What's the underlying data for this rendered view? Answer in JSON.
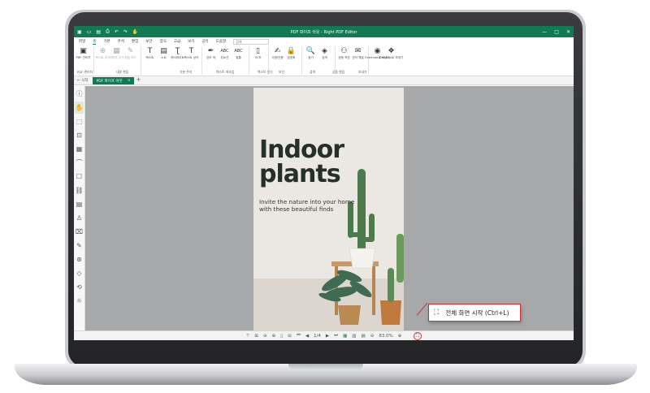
{
  "window": {
    "title": "PDF 파이프 아웃 - Right PDF Editor",
    "controls": [
      "—",
      "□",
      "✕"
    ]
  },
  "menu": {
    "items": [
      "파일",
      "홈",
      "기본",
      "주석",
      "편집",
      "보안",
      "양식",
      "고급",
      "보기",
      "공유",
      "도움말"
    ],
    "active_index": 1,
    "search_placeholder": "검색"
  },
  "ribbon": {
    "items": [
      {
        "icon": "pdf-manage-icon",
        "glyph": "▣",
        "label": "PDF 관리자"
      },
      {
        "icon": "add-text-icon",
        "glyph": "⊕",
        "label": "텍스트 추가",
        "dim": true
      },
      {
        "icon": "add-image-icon",
        "glyph": "▦",
        "label": "이미지 추가",
        "dim": true
      },
      {
        "icon": "edit-icon",
        "glyph": "✎",
        "label": "편집 모드",
        "dim": true
      },
      {
        "icon": "text-icon",
        "glyph": "T",
        "label": "텍스트"
      },
      {
        "icon": "note-icon",
        "glyph": "▤",
        "label": "노트"
      },
      {
        "icon": "highlight-icon",
        "glyph": "Ʈ",
        "label": "하이라이트"
      },
      {
        "icon": "textbox-icon",
        "glyph": "T",
        "label": "텍스트 상자"
      },
      {
        "icon": "sign-icon",
        "glyph": "✒",
        "label": "강조 색"
      },
      {
        "icon": "abc-icon",
        "glyph": "ABC",
        "label": "취소선"
      },
      {
        "icon": "abc2-icon",
        "glyph": "ABC",
        "label": "밑줄"
      },
      {
        "icon": "ocr-icon",
        "glyph": "▯",
        "label": "OCR"
      },
      {
        "icon": "stamp-icon",
        "glyph": "✍",
        "label": "서명/인증"
      },
      {
        "icon": "lock-icon",
        "glyph": "🔒",
        "label": "암호화"
      },
      {
        "icon": "search-icon",
        "glyph": "🔍",
        "label": "찾기"
      },
      {
        "icon": "car-icon",
        "glyph": "◈",
        "label": "검색"
      },
      {
        "icon": "share-icon",
        "glyph": "⚇",
        "label": "공동 작업"
      },
      {
        "icon": "email-icon",
        "glyph": "✉",
        "label": "전자 메일"
      },
      {
        "icon": "evernote-icon",
        "glyph": "◉",
        "label": "Evernote로 보내기"
      },
      {
        "icon": "dropbox-icon",
        "glyph": "❖",
        "label": "Dropbox로 보내기"
      }
    ],
    "groups": [
      "PDF 관리자",
      "내용 편집",
      "기본 주석",
      "텍스트 마크업",
      "텍스트 인식",
      "보안",
      "검색",
      "공동 편집",
      "보내기"
    ]
  },
  "tabs": {
    "home": "← 시작",
    "doc": "PDF 파이프 아웃",
    "close": "×",
    "add": "+"
  },
  "sidebar": {
    "icons": [
      "info-icon",
      "hand-icon",
      "select-icon",
      "bookmark-icon",
      "thumbnails-icon",
      "attachment-icon",
      "comment-icon",
      "link-icon",
      "layers-icon",
      "stamp-icon",
      "signature-icon",
      "pen-icon",
      "globe-icon",
      "tag-icon",
      "history-icon",
      "accessibility-icon"
    ],
    "glyphs": [
      "ⓘ",
      "✋",
      "⬚",
      "⊡",
      "▦",
      "⌒",
      "☐",
      "⛓",
      "▤",
      "♙",
      "⌧",
      "✎",
      "⊛",
      "◇",
      "⟲",
      "☼"
    ]
  },
  "page": {
    "heading_line1": "Indoor",
    "heading_line2": "plants",
    "tagline_line1": "Invite the nature into your home",
    "tagline_line2": "with these beautiful finds"
  },
  "statusbar": {
    "controls": [
      "⊤",
      "⊞",
      "⊖",
      "⊕",
      "▯",
      "⊟",
      "⏮",
      "◀",
      "1/4",
      "▶",
      "⏭",
      "▦",
      "▥",
      "▤",
      "⊖",
      "83.0%",
      "⊕"
    ],
    "zoom": "83.0%",
    "page_indicator": "1/4"
  },
  "tooltip": {
    "text": "전체 화면 시작 (Ctrl+L)",
    "icon": "fullscreen-icon"
  },
  "colors": {
    "brand": "#0f7a54",
    "canvas": "#a6a8aa",
    "tooltip_border": "#cc3333"
  }
}
